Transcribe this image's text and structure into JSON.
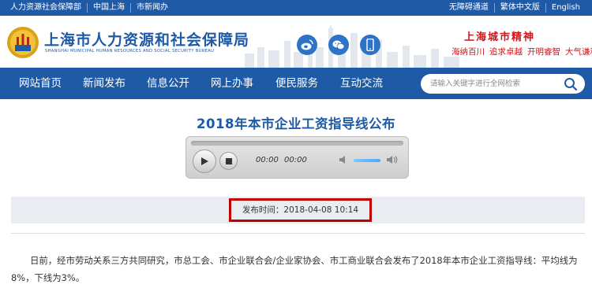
{
  "topbar": {
    "left_links": [
      "人力资源社会保障部",
      "中国上海",
      "市新闻办"
    ],
    "right_links": [
      "无障碍通道",
      "繁体中文版",
      "English"
    ]
  },
  "header": {
    "title": "上海市人力资源和社会保障局",
    "subtitle": "SHANGHAI MUNICIPAL HUMAN RESOURCES AND SOCIAL SECURITY BUREAU",
    "spirit_title": "上海城市精神",
    "spirit_items": [
      "海纳百川",
      "追求卓越",
      "开明睿智",
      "大气谦和"
    ]
  },
  "nav": {
    "items": [
      "网站首页",
      "新闻发布",
      "信息公开",
      "网上办事",
      "便民服务",
      "互动交流"
    ],
    "search_placeholder": "请输入关键字进行全网检索"
  },
  "article": {
    "title": "2018年本市企业工资指导线公布",
    "published": "发布时间：2018-04-08 10:14",
    "body": "日前，经市劳动关系三方共同研究，市总工会、市企业联合会/企业家协会、市工商业联合会发布了2018年本市企业工资指导线：平均线为8%，下线为3%。"
  },
  "player": {
    "current_time": "00:00",
    "duration": "00:00"
  },
  "colors": {
    "brand_blue": "#1f5aa6",
    "accent_red": "#c00000"
  }
}
